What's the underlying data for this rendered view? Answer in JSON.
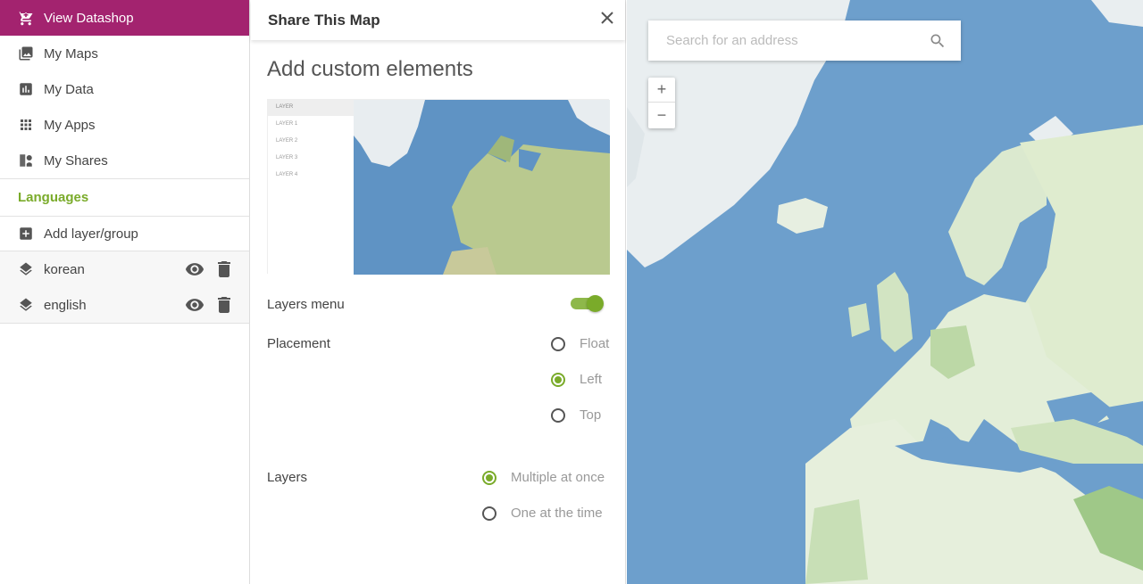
{
  "sidebar": {
    "datashop_label": "View Datashop",
    "nav": [
      {
        "label": "My Maps",
        "icon": "image-icon"
      },
      {
        "label": "My Data",
        "icon": "chart-icon"
      },
      {
        "label": "My Apps",
        "icon": "apps-grid-icon"
      },
      {
        "label": "My Shares",
        "icon": "share-icon"
      }
    ],
    "languages_title": "Languages",
    "add_layer_label": "Add layer/group",
    "layers": [
      {
        "label": "korean"
      },
      {
        "label": "english"
      }
    ]
  },
  "panel": {
    "title": "Share This Map",
    "subtitle": "Add custom elements",
    "preview": {
      "header": "LAYER",
      "items": [
        "LAYER 1",
        "LAYER 2",
        "LAYER 3",
        "LAYER 4"
      ]
    },
    "layers_menu_label": "Layers menu",
    "layers_menu_on": true,
    "placement_label": "Placement",
    "placement_options": [
      "Float",
      "Left",
      "Top"
    ],
    "placement_selected": "Left",
    "layers_label": "Layers",
    "layers_options": [
      "Multiple at once",
      "One at the time"
    ],
    "layers_selected": "Multiple at once"
  },
  "map": {
    "search_placeholder": "Search for an address",
    "zoom_in": "+",
    "zoom_out": "−"
  },
  "colors": {
    "brand": "#a3236f",
    "accent": "#7aab2a",
    "ocean": "#6d9fcc",
    "land": "#dbe9cf"
  }
}
